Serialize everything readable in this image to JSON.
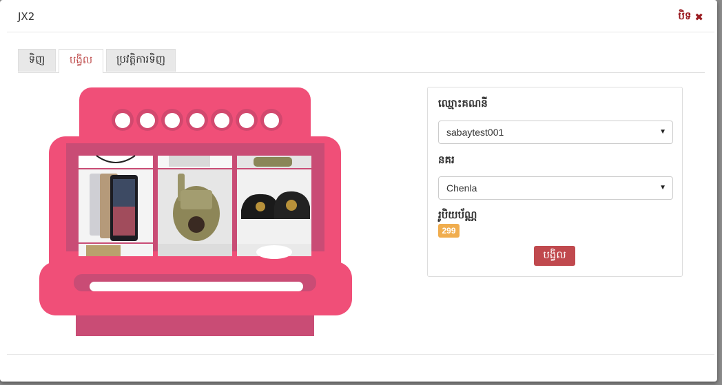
{
  "header": {
    "title": "JX2",
    "close_label": "បិទ"
  },
  "tabs": [
    {
      "label": "ទិញ"
    },
    {
      "label": "បង្វិល"
    },
    {
      "label": "ប្រវត្តិការទិញ"
    }
  ],
  "form": {
    "account_label": "ឈ្មោះគណនី",
    "account_value": "sabaytest001",
    "server_label": "នគរ",
    "server_value": "Chenla",
    "currency_label": "រូបិយប័ណ្ណ",
    "currency_amount": "299",
    "submit_label": "បង្វិល"
  },
  "colors": {
    "machine": "#f04f78",
    "machine_dark": "#c94c75",
    "accent": "#c0494e",
    "badge": "#f0ad4e"
  }
}
